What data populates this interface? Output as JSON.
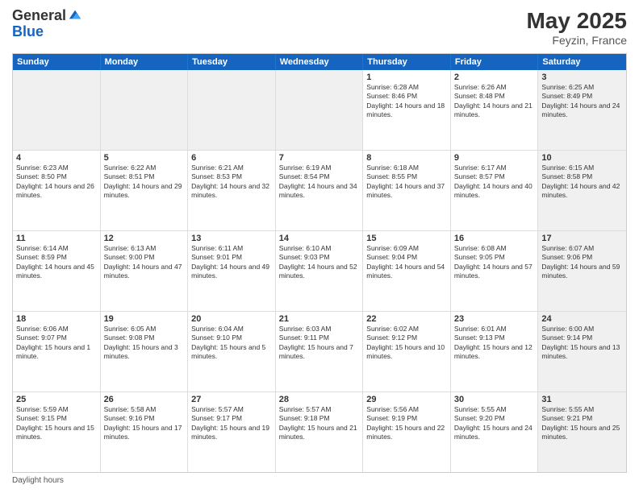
{
  "header": {
    "logo_general": "General",
    "logo_blue": "Blue",
    "month_year": "May 2025",
    "location": "Feyzin, France"
  },
  "days_of_week": [
    "Sunday",
    "Monday",
    "Tuesday",
    "Wednesday",
    "Thursday",
    "Friday",
    "Saturday"
  ],
  "weeks": [
    [
      {
        "day": "",
        "sunrise": "",
        "sunset": "",
        "daylight": "",
        "shaded": true
      },
      {
        "day": "",
        "sunrise": "",
        "sunset": "",
        "daylight": "",
        "shaded": true
      },
      {
        "day": "",
        "sunrise": "",
        "sunset": "",
        "daylight": "",
        "shaded": true
      },
      {
        "day": "",
        "sunrise": "",
        "sunset": "",
        "daylight": "",
        "shaded": true
      },
      {
        "day": "1",
        "sunrise": "Sunrise: 6:28 AM",
        "sunset": "Sunset: 8:46 PM",
        "daylight": "Daylight: 14 hours and 18 minutes.",
        "shaded": false
      },
      {
        "day": "2",
        "sunrise": "Sunrise: 6:26 AM",
        "sunset": "Sunset: 8:48 PM",
        "daylight": "Daylight: 14 hours and 21 minutes.",
        "shaded": false
      },
      {
        "day": "3",
        "sunrise": "Sunrise: 6:25 AM",
        "sunset": "Sunset: 8:49 PM",
        "daylight": "Daylight: 14 hours and 24 minutes.",
        "shaded": true
      }
    ],
    [
      {
        "day": "4",
        "sunrise": "Sunrise: 6:23 AM",
        "sunset": "Sunset: 8:50 PM",
        "daylight": "Daylight: 14 hours and 26 minutes.",
        "shaded": false
      },
      {
        "day": "5",
        "sunrise": "Sunrise: 6:22 AM",
        "sunset": "Sunset: 8:51 PM",
        "daylight": "Daylight: 14 hours and 29 minutes.",
        "shaded": false
      },
      {
        "day": "6",
        "sunrise": "Sunrise: 6:21 AM",
        "sunset": "Sunset: 8:53 PM",
        "daylight": "Daylight: 14 hours and 32 minutes.",
        "shaded": false
      },
      {
        "day": "7",
        "sunrise": "Sunrise: 6:19 AM",
        "sunset": "Sunset: 8:54 PM",
        "daylight": "Daylight: 14 hours and 34 minutes.",
        "shaded": false
      },
      {
        "day": "8",
        "sunrise": "Sunrise: 6:18 AM",
        "sunset": "Sunset: 8:55 PM",
        "daylight": "Daylight: 14 hours and 37 minutes.",
        "shaded": false
      },
      {
        "day": "9",
        "sunrise": "Sunrise: 6:17 AM",
        "sunset": "Sunset: 8:57 PM",
        "daylight": "Daylight: 14 hours and 40 minutes.",
        "shaded": false
      },
      {
        "day": "10",
        "sunrise": "Sunrise: 6:15 AM",
        "sunset": "Sunset: 8:58 PM",
        "daylight": "Daylight: 14 hours and 42 minutes.",
        "shaded": true
      }
    ],
    [
      {
        "day": "11",
        "sunrise": "Sunrise: 6:14 AM",
        "sunset": "Sunset: 8:59 PM",
        "daylight": "Daylight: 14 hours and 45 minutes.",
        "shaded": false
      },
      {
        "day": "12",
        "sunrise": "Sunrise: 6:13 AM",
        "sunset": "Sunset: 9:00 PM",
        "daylight": "Daylight: 14 hours and 47 minutes.",
        "shaded": false
      },
      {
        "day": "13",
        "sunrise": "Sunrise: 6:11 AM",
        "sunset": "Sunset: 9:01 PM",
        "daylight": "Daylight: 14 hours and 49 minutes.",
        "shaded": false
      },
      {
        "day": "14",
        "sunrise": "Sunrise: 6:10 AM",
        "sunset": "Sunset: 9:03 PM",
        "daylight": "Daylight: 14 hours and 52 minutes.",
        "shaded": false
      },
      {
        "day": "15",
        "sunrise": "Sunrise: 6:09 AM",
        "sunset": "Sunset: 9:04 PM",
        "daylight": "Daylight: 14 hours and 54 minutes.",
        "shaded": false
      },
      {
        "day": "16",
        "sunrise": "Sunrise: 6:08 AM",
        "sunset": "Sunset: 9:05 PM",
        "daylight": "Daylight: 14 hours and 57 minutes.",
        "shaded": false
      },
      {
        "day": "17",
        "sunrise": "Sunrise: 6:07 AM",
        "sunset": "Sunset: 9:06 PM",
        "daylight": "Daylight: 14 hours and 59 minutes.",
        "shaded": true
      }
    ],
    [
      {
        "day": "18",
        "sunrise": "Sunrise: 6:06 AM",
        "sunset": "Sunset: 9:07 PM",
        "daylight": "Daylight: 15 hours and 1 minute.",
        "shaded": false
      },
      {
        "day": "19",
        "sunrise": "Sunrise: 6:05 AM",
        "sunset": "Sunset: 9:08 PM",
        "daylight": "Daylight: 15 hours and 3 minutes.",
        "shaded": false
      },
      {
        "day": "20",
        "sunrise": "Sunrise: 6:04 AM",
        "sunset": "Sunset: 9:10 PM",
        "daylight": "Daylight: 15 hours and 5 minutes.",
        "shaded": false
      },
      {
        "day": "21",
        "sunrise": "Sunrise: 6:03 AM",
        "sunset": "Sunset: 9:11 PM",
        "daylight": "Daylight: 15 hours and 7 minutes.",
        "shaded": false
      },
      {
        "day": "22",
        "sunrise": "Sunrise: 6:02 AM",
        "sunset": "Sunset: 9:12 PM",
        "daylight": "Daylight: 15 hours and 10 minutes.",
        "shaded": false
      },
      {
        "day": "23",
        "sunrise": "Sunrise: 6:01 AM",
        "sunset": "Sunset: 9:13 PM",
        "daylight": "Daylight: 15 hours and 12 minutes.",
        "shaded": false
      },
      {
        "day": "24",
        "sunrise": "Sunrise: 6:00 AM",
        "sunset": "Sunset: 9:14 PM",
        "daylight": "Daylight: 15 hours and 13 minutes.",
        "shaded": true
      }
    ],
    [
      {
        "day": "25",
        "sunrise": "Sunrise: 5:59 AM",
        "sunset": "Sunset: 9:15 PM",
        "daylight": "Daylight: 15 hours and 15 minutes.",
        "shaded": false
      },
      {
        "day": "26",
        "sunrise": "Sunrise: 5:58 AM",
        "sunset": "Sunset: 9:16 PM",
        "daylight": "Daylight: 15 hours and 17 minutes.",
        "shaded": false
      },
      {
        "day": "27",
        "sunrise": "Sunrise: 5:57 AM",
        "sunset": "Sunset: 9:17 PM",
        "daylight": "Daylight: 15 hours and 19 minutes.",
        "shaded": false
      },
      {
        "day": "28",
        "sunrise": "Sunrise: 5:57 AM",
        "sunset": "Sunset: 9:18 PM",
        "daylight": "Daylight: 15 hours and 21 minutes.",
        "shaded": false
      },
      {
        "day": "29",
        "sunrise": "Sunrise: 5:56 AM",
        "sunset": "Sunset: 9:19 PM",
        "daylight": "Daylight: 15 hours and 22 minutes.",
        "shaded": false
      },
      {
        "day": "30",
        "sunrise": "Sunrise: 5:55 AM",
        "sunset": "Sunset: 9:20 PM",
        "daylight": "Daylight: 15 hours and 24 minutes.",
        "shaded": false
      },
      {
        "day": "31",
        "sunrise": "Sunrise: 5:55 AM",
        "sunset": "Sunset: 9:21 PM",
        "daylight": "Daylight: 15 hours and 25 minutes.",
        "shaded": true
      }
    ]
  ],
  "footer": {
    "note": "Daylight hours"
  }
}
